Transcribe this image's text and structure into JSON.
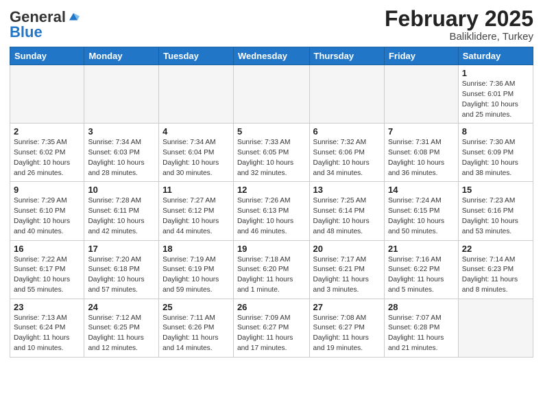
{
  "header": {
    "logo_general": "General",
    "logo_blue": "Blue",
    "month_title": "February 2025",
    "location": "Baliklidere, Turkey"
  },
  "weekdays": [
    "Sunday",
    "Monday",
    "Tuesday",
    "Wednesday",
    "Thursday",
    "Friday",
    "Saturday"
  ],
  "weeks": [
    [
      {
        "day": "",
        "empty": true
      },
      {
        "day": "",
        "empty": true
      },
      {
        "day": "",
        "empty": true
      },
      {
        "day": "",
        "empty": true
      },
      {
        "day": "",
        "empty": true
      },
      {
        "day": "",
        "empty": true
      },
      {
        "day": "1",
        "sunrise": "Sunrise: 7:36 AM",
        "sunset": "Sunset: 6:01 PM",
        "daylight": "Daylight: 10 hours and 25 minutes."
      }
    ],
    [
      {
        "day": "2",
        "sunrise": "Sunrise: 7:35 AM",
        "sunset": "Sunset: 6:02 PM",
        "daylight": "Daylight: 10 hours and 26 minutes."
      },
      {
        "day": "3",
        "sunrise": "Sunrise: 7:34 AM",
        "sunset": "Sunset: 6:03 PM",
        "daylight": "Daylight: 10 hours and 28 minutes."
      },
      {
        "day": "4",
        "sunrise": "Sunrise: 7:34 AM",
        "sunset": "Sunset: 6:04 PM",
        "daylight": "Daylight: 10 hours and 30 minutes."
      },
      {
        "day": "5",
        "sunrise": "Sunrise: 7:33 AM",
        "sunset": "Sunset: 6:05 PM",
        "daylight": "Daylight: 10 hours and 32 minutes."
      },
      {
        "day": "6",
        "sunrise": "Sunrise: 7:32 AM",
        "sunset": "Sunset: 6:06 PM",
        "daylight": "Daylight: 10 hours and 34 minutes."
      },
      {
        "day": "7",
        "sunrise": "Sunrise: 7:31 AM",
        "sunset": "Sunset: 6:08 PM",
        "daylight": "Daylight: 10 hours and 36 minutes."
      },
      {
        "day": "8",
        "sunrise": "Sunrise: 7:30 AM",
        "sunset": "Sunset: 6:09 PM",
        "daylight": "Daylight: 10 hours and 38 minutes."
      }
    ],
    [
      {
        "day": "9",
        "sunrise": "Sunrise: 7:29 AM",
        "sunset": "Sunset: 6:10 PM",
        "daylight": "Daylight: 10 hours and 40 minutes."
      },
      {
        "day": "10",
        "sunrise": "Sunrise: 7:28 AM",
        "sunset": "Sunset: 6:11 PM",
        "daylight": "Daylight: 10 hours and 42 minutes."
      },
      {
        "day": "11",
        "sunrise": "Sunrise: 7:27 AM",
        "sunset": "Sunset: 6:12 PM",
        "daylight": "Daylight: 10 hours and 44 minutes."
      },
      {
        "day": "12",
        "sunrise": "Sunrise: 7:26 AM",
        "sunset": "Sunset: 6:13 PM",
        "daylight": "Daylight: 10 hours and 46 minutes."
      },
      {
        "day": "13",
        "sunrise": "Sunrise: 7:25 AM",
        "sunset": "Sunset: 6:14 PM",
        "daylight": "Daylight: 10 hours and 48 minutes."
      },
      {
        "day": "14",
        "sunrise": "Sunrise: 7:24 AM",
        "sunset": "Sunset: 6:15 PM",
        "daylight": "Daylight: 10 hours and 50 minutes."
      },
      {
        "day": "15",
        "sunrise": "Sunrise: 7:23 AM",
        "sunset": "Sunset: 6:16 PM",
        "daylight": "Daylight: 10 hours and 53 minutes."
      }
    ],
    [
      {
        "day": "16",
        "sunrise": "Sunrise: 7:22 AM",
        "sunset": "Sunset: 6:17 PM",
        "daylight": "Daylight: 10 hours and 55 minutes."
      },
      {
        "day": "17",
        "sunrise": "Sunrise: 7:20 AM",
        "sunset": "Sunset: 6:18 PM",
        "daylight": "Daylight: 10 hours and 57 minutes."
      },
      {
        "day": "18",
        "sunrise": "Sunrise: 7:19 AM",
        "sunset": "Sunset: 6:19 PM",
        "daylight": "Daylight: 10 hours and 59 minutes."
      },
      {
        "day": "19",
        "sunrise": "Sunrise: 7:18 AM",
        "sunset": "Sunset: 6:20 PM",
        "daylight": "Daylight: 11 hours and 1 minute."
      },
      {
        "day": "20",
        "sunrise": "Sunrise: 7:17 AM",
        "sunset": "Sunset: 6:21 PM",
        "daylight": "Daylight: 11 hours and 3 minutes."
      },
      {
        "day": "21",
        "sunrise": "Sunrise: 7:16 AM",
        "sunset": "Sunset: 6:22 PM",
        "daylight": "Daylight: 11 hours and 5 minutes."
      },
      {
        "day": "22",
        "sunrise": "Sunrise: 7:14 AM",
        "sunset": "Sunset: 6:23 PM",
        "daylight": "Daylight: 11 hours and 8 minutes."
      }
    ],
    [
      {
        "day": "23",
        "sunrise": "Sunrise: 7:13 AM",
        "sunset": "Sunset: 6:24 PM",
        "daylight": "Daylight: 11 hours and 10 minutes."
      },
      {
        "day": "24",
        "sunrise": "Sunrise: 7:12 AM",
        "sunset": "Sunset: 6:25 PM",
        "daylight": "Daylight: 11 hours and 12 minutes."
      },
      {
        "day": "25",
        "sunrise": "Sunrise: 7:11 AM",
        "sunset": "Sunset: 6:26 PM",
        "daylight": "Daylight: 11 hours and 14 minutes."
      },
      {
        "day": "26",
        "sunrise": "Sunrise: 7:09 AM",
        "sunset": "Sunset: 6:27 PM",
        "daylight": "Daylight: 11 hours and 17 minutes."
      },
      {
        "day": "27",
        "sunrise": "Sunrise: 7:08 AM",
        "sunset": "Sunset: 6:27 PM",
        "daylight": "Daylight: 11 hours and 19 minutes."
      },
      {
        "day": "28",
        "sunrise": "Sunrise: 7:07 AM",
        "sunset": "Sunset: 6:28 PM",
        "daylight": "Daylight: 11 hours and 21 minutes."
      },
      {
        "day": "",
        "empty": true
      }
    ]
  ]
}
